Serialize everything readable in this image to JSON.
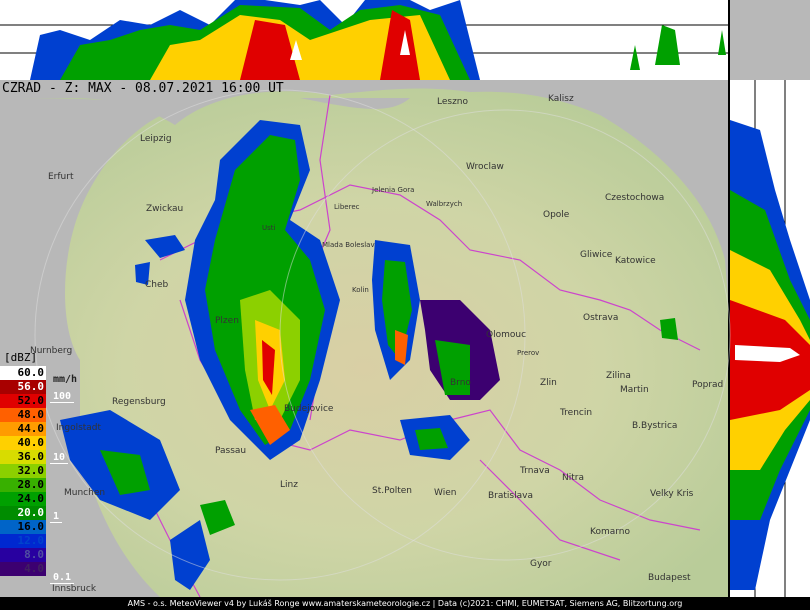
{
  "header": {
    "title": "CZRAD - Z: MAX - 08.07.2021 16:00 UT"
  },
  "legend": {
    "unit_dbz": "[dBZ]",
    "unit_rate": "mm/h",
    "levels": [
      {
        "value": "60.0",
        "color": "#ffffff",
        "text": "#000000"
      },
      {
        "value": "56.0",
        "color": "#a80000",
        "text": "#ffffff"
      },
      {
        "value": "52.0",
        "color": "#e00000",
        "text": "#000000"
      },
      {
        "value": "48.0",
        "color": "#ff6000",
        "text": "#000000"
      },
      {
        "value": "44.0",
        "color": "#ff9c00",
        "text": "#000000"
      },
      {
        "value": "40.0",
        "color": "#ffd000",
        "text": "#000000"
      },
      {
        "value": "36.0",
        "color": "#d8dc00",
        "text": "#000000"
      },
      {
        "value": "32.0",
        "color": "#8cd000",
        "text": "#000000"
      },
      {
        "value": "28.0",
        "color": "#38b000",
        "text": "#000000"
      },
      {
        "value": "24.0",
        "color": "#00a000",
        "text": "#000000"
      },
      {
        "value": "20.0",
        "color": "#008c00",
        "text": "#ffffff"
      },
      {
        "value": "16.0",
        "color": "#0064c8",
        "text": "#000000"
      },
      {
        "value": "12.0",
        "color": "#0028d0",
        "text": "#0044cc"
      },
      {
        "value": "8.0",
        "color": "#2800a0",
        "text": "#5050a0"
      },
      {
        "value": "4.0",
        "color": "#3c0070",
        "text": "#402060"
      }
    ],
    "rates": [
      "100",
      "10",
      "1",
      "0.1"
    ]
  },
  "places": [
    {
      "name": "Leszno"
    },
    {
      "name": "Kalisz"
    },
    {
      "name": "Leipzig"
    },
    {
      "name": "Wroclaw"
    },
    {
      "name": "Erfurt"
    },
    {
      "name": "Jelenia Gora"
    },
    {
      "name": "Walbrzych"
    },
    {
      "name": "Czestochowa"
    },
    {
      "name": "Zwickau"
    },
    {
      "name": "Opole"
    },
    {
      "name": "Liberec"
    },
    {
      "name": "Usti"
    },
    {
      "name": "Mlada Boleslav"
    },
    {
      "name": "Gliwice"
    },
    {
      "name": "Katowice"
    },
    {
      "name": "Cheb"
    },
    {
      "name": "Kolin"
    },
    {
      "name": "Ostrava"
    },
    {
      "name": "Plzen"
    },
    {
      "name": "Olomouc"
    },
    {
      "name": "Nurnberg"
    },
    {
      "name": "Prerov"
    },
    {
      "name": "Zilina"
    },
    {
      "name": "Martin"
    },
    {
      "name": "Poprad"
    },
    {
      "name": "Brno"
    },
    {
      "name": "Zlin"
    },
    {
      "name": "Regensburg"
    },
    {
      "name": "Budejovice"
    },
    {
      "name": "Trencin"
    },
    {
      "name": "B.Bystrica"
    },
    {
      "name": "Ingolstadt"
    },
    {
      "name": "Passau"
    },
    {
      "name": "Trnava"
    },
    {
      "name": "Nitra"
    },
    {
      "name": "Munchen"
    },
    {
      "name": "Linz"
    },
    {
      "name": "St.Polten"
    },
    {
      "name": "Wien"
    },
    {
      "name": "Bratislava"
    },
    {
      "name": "Velky Kris"
    },
    {
      "name": "Komarno"
    },
    {
      "name": "Gyor"
    },
    {
      "name": "Budapest"
    },
    {
      "name": "Innsbruck"
    }
  ],
  "footer": {
    "text": "AMS - o.s. MeteoViewer v4 by Lukáš Ronge www.amaterskameteorologie.cz | Data (c)2021: CHMI, EUMETSAT, Siemens AG, Blitzortung.org"
  }
}
